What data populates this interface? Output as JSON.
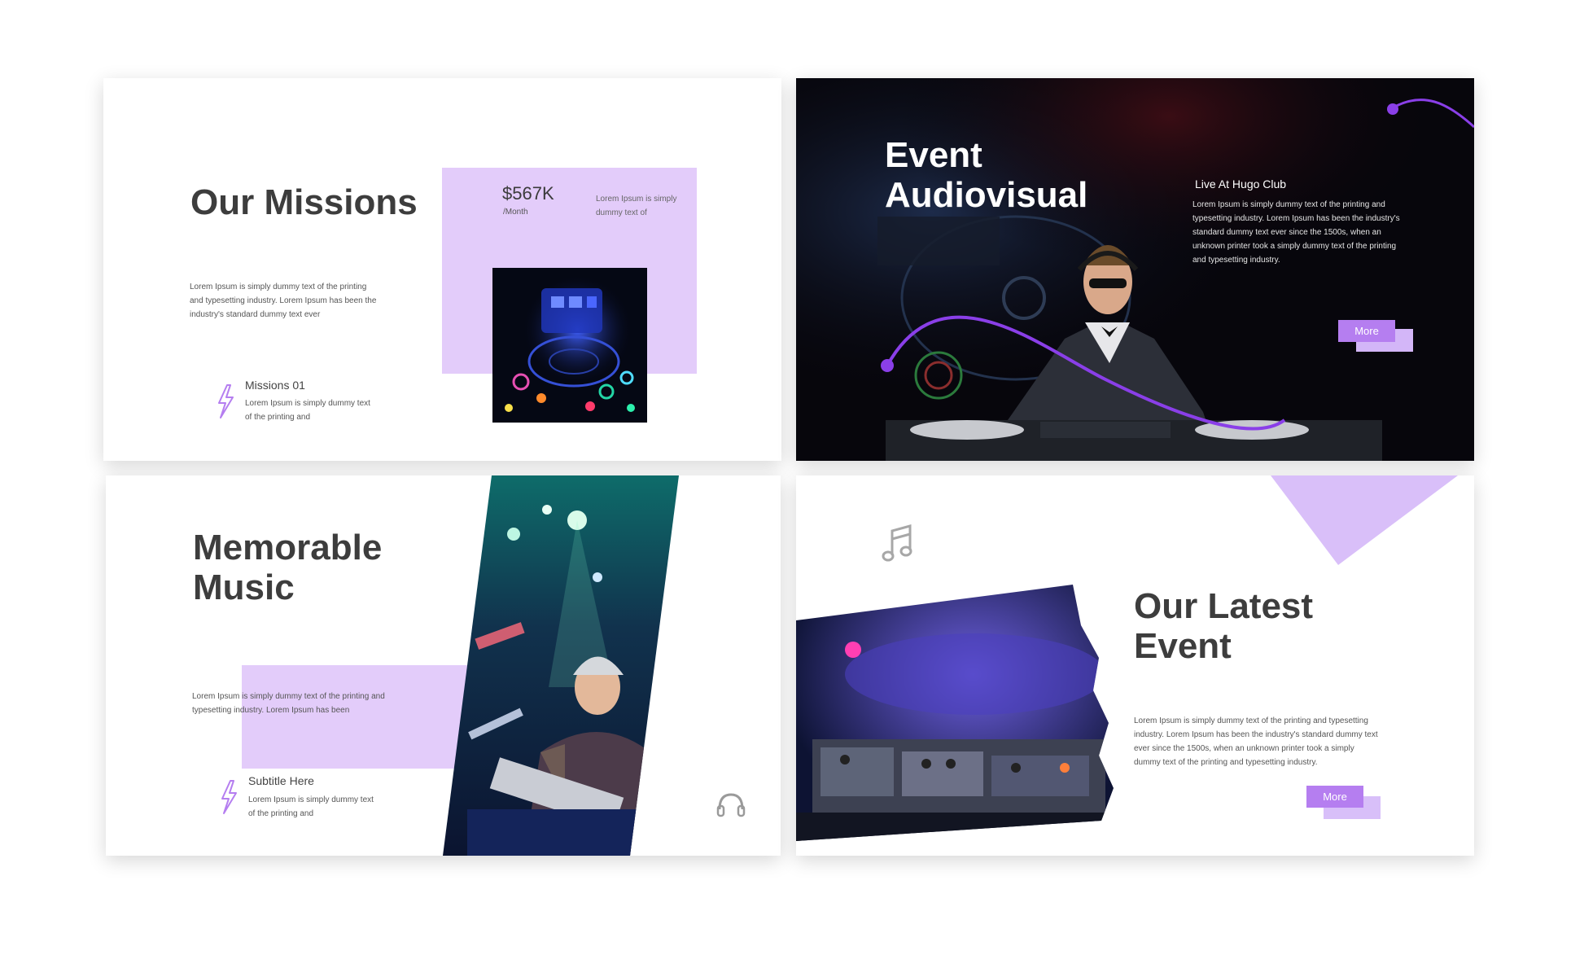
{
  "slide1": {
    "title": "Our Missions",
    "price": "$567K",
    "price_unit": "/Month",
    "price_desc": "Lorem Ipsum is simply dummy text of",
    "desc": "Lorem Ipsum is simply dummy text of the printing and typesetting industry. Lorem Ipsum has been the industry's standard dummy text ever",
    "mission_title": "Missions 01",
    "mission_desc": "Lorem Ipsum is simply dummy text of the printing and"
  },
  "slide2": {
    "title_line1": "Event",
    "title_line2": "Audiovisual",
    "subtitle": "Live At Hugo Club",
    "desc": "Lorem Ipsum is simply dummy text of the printing and typesetting industry. Lorem Ipsum has been the industry's standard dummy text ever since the 1500s, when an unknown printer took a simply dummy text of the printing and typesetting industry.",
    "button": "More"
  },
  "slide3": {
    "title_line1": "Memorable",
    "title_line2": "Music",
    "desc": "Lorem Ipsum is simply dummy text of the printing and typesetting industry. Lorem Ipsum has been",
    "subtitle": "Subtitle Here",
    "sub_desc": "Lorem Ipsum is simply dummy text of the printing and"
  },
  "slide4": {
    "title_line1": "Our Latest",
    "title_line2": "Event",
    "desc": "Lorem Ipsum is simply dummy text of the printing and typesetting industry. Lorem Ipsum has been the industry's standard dummy text ever since the 1500s, when an unknown printer took a simply dummy text of the printing and typesetting industry.",
    "button": "More"
  },
  "colors": {
    "accent": "#b57ef0",
    "light_purple": "#e3ccfa",
    "text_dark": "#3d3d3d"
  },
  "icons": [
    "lightning-icon",
    "headphones-icon",
    "music-notes-icon"
  ]
}
